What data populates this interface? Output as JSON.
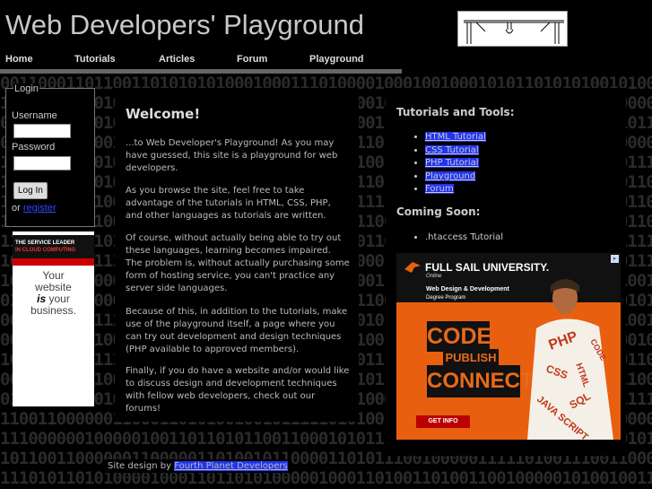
{
  "site": {
    "title": "Web Developers' Playground"
  },
  "nav": [
    {
      "label": "Home"
    },
    {
      "label": "Tutorials"
    },
    {
      "label": "Articles"
    },
    {
      "label": "Forum"
    },
    {
      "label": "Playground"
    }
  ],
  "login": {
    "legend": "Login",
    "username_label": "Username",
    "password_label": "Password",
    "login_button": "Log In",
    "or_text": "or",
    "register_link": "register"
  },
  "left_ad": {
    "headline_1": "THE SERVICE LEADER",
    "headline_2": "IN CLOUD COMPUTING",
    "line_1": "Your",
    "line_2": "website",
    "line_3_em": "is",
    "line_3_rest": "your",
    "line_4": "business."
  },
  "main": {
    "heading": "Welcome!",
    "paragraphs": [
      "...to Web Developer's Playground! As you may have guessed, this site is a playground for web developers.",
      "As you browse the site, feel free to take advantage of the tutorials in HTML, CSS, PHP, and other languages as tutorials are written.",
      "Of course, without actually being able to try out these languages, learning becomes impaired. The problem is, without actually purchasing some form of hosting service, you can't practice any server side languages.",
      "Because of this, in addition to the tutorials, make use of the playground itself, a page where you can try out development and design techniques (PHP available to approved members).",
      "Finally, if you do have a website and/or would like to discuss design and development techniques with fellow web developers, check out our forums!"
    ]
  },
  "sidebar": {
    "tools_heading": "Tutorials and Tools:",
    "tools": [
      {
        "label": "HTML Tutorial"
      },
      {
        "label": "CSS Tutorial"
      },
      {
        "label": "PHP Tutorial"
      },
      {
        "label": "Playground"
      },
      {
        "label": "Forum"
      }
    ],
    "soon_heading": "Coming Soon:",
    "soon": [
      {
        "label": ".htaccess Tutorial"
      }
    ]
  },
  "right_ad": {
    "brand": "FULL SAIL UNIVERSITY.",
    "sub": "Online",
    "program": "Web Design & Development",
    "program_sub": "Degree Program",
    "word_1": "CODE",
    "word_2": "PUBLISH",
    "word_3": "CONNECT",
    "cta": "GET INFO",
    "shirt_words": [
      "PHP",
      "CSS",
      "HTML",
      "JAVA SCRIPT",
      "SQL",
      "CODE"
    ]
  },
  "footer": {
    "prefix": "Site design by",
    "link": "Fourth Planet Developers"
  },
  "colors": {
    "background": "#000000",
    "link_highlight": "#2233ee",
    "nav_underline": "#666666",
    "ad_orange": "#e85f10"
  }
}
